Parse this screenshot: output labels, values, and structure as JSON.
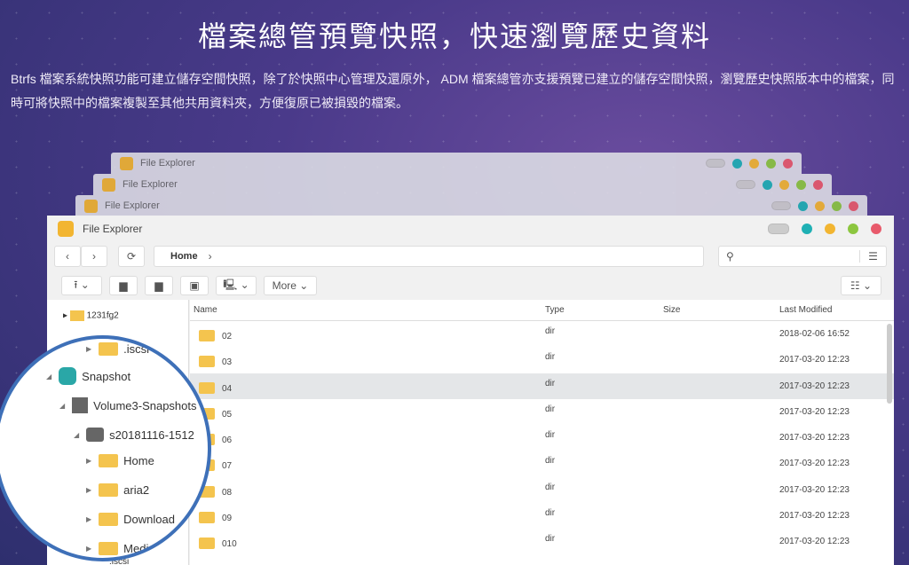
{
  "headline": "檔案總管預覽快照，快速瀏覽歷史資料",
  "description": "Btrfs 檔案系統快照功能可建立儲存空間快照，除了於快照中心管理及還原外， ADM 檔案總管亦支援預覽已建立的儲存空間快照，瀏覽歷史快照版本中的檔案，同時可將快照中的檔案複製至其他共用資料夾，方便復原已被損毀的檔案。",
  "window_title": "File Explorer",
  "colors": {
    "teal": "#1fb0b4",
    "yellow": "#f2b531",
    "green": "#8cc63f",
    "red": "#e85a6b",
    "accent": "#3e70b8"
  },
  "breadcrumb": "Home",
  "toolbar": {
    "more": "More"
  },
  "columns": [
    "Name",
    "Type",
    "Size",
    "Last Modified"
  ],
  "rows": [
    {
      "name": "02",
      "type": "dir",
      "modified": "2018-02-06 16:52"
    },
    {
      "name": "03",
      "type": "dir",
      "modified": "2017-03-20 12:23"
    },
    {
      "name": "04",
      "type": "dir",
      "modified": "2017-03-20 12:23"
    },
    {
      "name": "05",
      "type": "dir",
      "modified": "2017-03-20 12:23"
    },
    {
      "name": "06",
      "type": "dir",
      "modified": "2017-03-20 12:23"
    },
    {
      "name": "07",
      "type": "dir",
      "modified": "2017-03-20 12:23"
    },
    {
      "name": "08",
      "type": "dir",
      "modified": "2017-03-20 12:23"
    },
    {
      "name": "09",
      "type": "dir",
      "modified": "2017-03-20 12:23"
    },
    {
      "name": "010",
      "type": "dir",
      "modified": "2017-03-20 12:23"
    }
  ],
  "tree": {
    "top": "1231fg2",
    "iscsi": ".iscsi",
    "snapshot": "Snapshot",
    "volume": "Volume3-Snapshots",
    "snap": "s20181116-1512",
    "folders": [
      "Home",
      "aria2",
      "Download",
      "Media"
    ],
    "bottom": ".iscsi"
  }
}
